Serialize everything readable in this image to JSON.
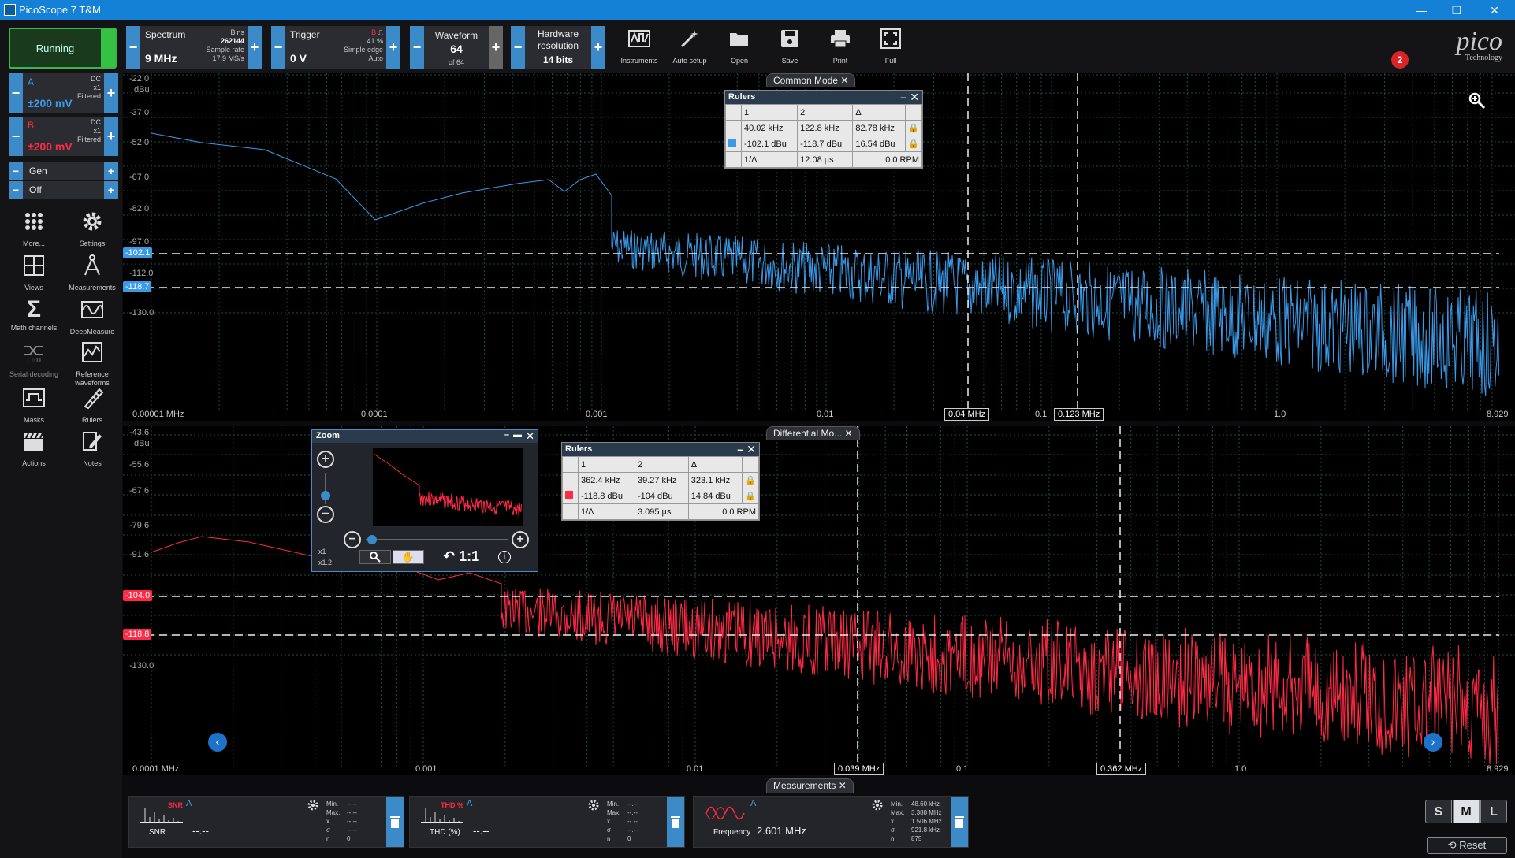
{
  "window": {
    "title": "PicoScope 7 T&M",
    "min": "—",
    "max": "❐",
    "close": "✕"
  },
  "toolbar": {
    "running": "Running",
    "spectrum": {
      "title": "Spectrum",
      "value": "9 MHz",
      "bins_label": "Bins",
      "bins": "262144",
      "rate_label": "Sample rate",
      "rate": "17.9 MS/s"
    },
    "trigger": {
      "title": "Trigger",
      "value": "0 V",
      "channel": "B",
      "percent": "41 %",
      "type": "Simple edge",
      "mode": "Auto"
    },
    "waveform": {
      "title": "Waveform",
      "value": "64",
      "of": "of 64"
    },
    "hardware": {
      "title1": "Hardware",
      "title2": "resolution",
      "value": "14 bits"
    },
    "tools": [
      "Instruments",
      "Auto setup",
      "Open",
      "Save",
      "Print",
      "Full"
    ],
    "logo": "pico",
    "logo_sub": "Technology",
    "badge": "2"
  },
  "channels": [
    {
      "letter": "A",
      "value": "±200 mV",
      "coupling": "DC",
      "probe": "x1",
      "filter": "Filtered",
      "color": "#3a9ae8"
    },
    {
      "letter": "B",
      "value": "±200 mV",
      "coupling": "DC",
      "probe": "x1",
      "filter": "Filtered",
      "color": "#ff2a45"
    }
  ],
  "gen": {
    "label": "Gen",
    "state": "Off"
  },
  "side_tools": [
    {
      "label": "More...",
      "icon": "grid-dots-icon"
    },
    {
      "label": "Settings",
      "icon": "gear-icon"
    },
    {
      "label": "Views",
      "icon": "views-icon"
    },
    {
      "label": "Measurements",
      "icon": "compass-icon"
    },
    {
      "label": "Math channels",
      "icon": "sigma-icon"
    },
    {
      "label": "DeepMeasure",
      "icon": "deepmeasure-icon"
    },
    {
      "label": "Serial decoding",
      "icon": "serial-icon"
    },
    {
      "label": "Reference waveforms",
      "icon": "reference-icon"
    },
    {
      "label": "Masks",
      "icon": "mask-icon"
    },
    {
      "label": "Rulers",
      "icon": "ruler-icon"
    },
    {
      "label": "Actions",
      "icon": "clapper-icon"
    },
    {
      "label": "Notes",
      "icon": "notes-icon"
    }
  ],
  "views": [
    {
      "tab": "Common Mode",
      "color": "#3a9ae8",
      "unit": "dBu",
      "yticks": [
        "-22.0",
        "-37.0",
        "-52.0",
        "-67.0",
        "-82.0",
        "-97.0",
        "-112.0",
        "-130.0"
      ],
      "xticks": [
        "0.00001 MHz",
        "0.0001",
        "0.001",
        "0.01",
        "0.1",
        "1.0",
        "8.929"
      ],
      "ruler_y": [
        "-102.1",
        "-118.7"
      ],
      "ruler_x": [
        "0.04 MHz",
        "0.123 MHz"
      ],
      "rulers": {
        "title": "Rulers",
        "cols": [
          "1",
          "2",
          "Δ"
        ],
        "row_x": [
          "40.02 kHz",
          "122.8 kHz",
          "82.78 kHz"
        ],
        "row_y": [
          "-102.1 dBu",
          "-118.7 dBu",
          "16.54 dBu"
        ],
        "inv_label": "1/Δ",
        "inv": "12.08 µs",
        "rpm": "0.0 RPM"
      }
    },
    {
      "tab": "Differential Mo...",
      "color": "#ff2a45",
      "unit": "dBu",
      "yticks": [
        "-43.6",
        "-55.6",
        "-67.6",
        "-79.6",
        "-91.6",
        "-104.0",
        "-118.8",
        "-130.0"
      ],
      "xticks": [
        "0.0001 MHz",
        "0.001",
        "0.01",
        "0.1",
        "1.0",
        "8.929"
      ],
      "ruler_y": [
        "-104.0",
        "-118.8"
      ],
      "ruler_x": [
        "0.039 MHz",
        "0.362 MHz"
      ],
      "rulers": {
        "title": "Rulers",
        "cols": [
          "1",
          "2",
          "Δ"
        ],
        "row_x": [
          "362.4 kHz",
          "39.27 kHz",
          "323.1 kHz"
        ],
        "row_y": [
          "-118.8 dBu",
          "-104 dBu",
          "14.84 dBu"
        ],
        "inv_label": "1/Δ",
        "inv": "3.095 µs",
        "rpm": "0.0 RPM"
      }
    }
  ],
  "zoom": {
    "title": "Zoom",
    "x1": "x1",
    "x12": "x1.2",
    "ratio": "1:1"
  },
  "measurements": {
    "tab": "Measurements",
    "cards": [
      {
        "name": "SNR",
        "icon_label": "SNR",
        "channel": "A",
        "value": "--.--",
        "min_label": "Min.",
        "min": "--.--",
        "max_label": "Max.",
        "max": "--.--",
        "mean_label": "x̄",
        "mean": "--.--",
        "sigma_label": "σ",
        "sigma": "--.--",
        "n_label": "n",
        "n": "0"
      },
      {
        "name": "THD (%)",
        "icon_label": "THD %",
        "channel": "A",
        "value": "--.--",
        "min_label": "Min.",
        "min": "--.--",
        "max_label": "Max.",
        "max": "--.--",
        "mean_label": "x̄",
        "mean": "--.--",
        "sigma_label": "σ",
        "sigma": "--.--",
        "n_label": "n",
        "n": "0"
      },
      {
        "name": "Frequency",
        "icon_label": "",
        "channel": "A",
        "value": "2.601 MHz",
        "min_label": "Min.",
        "min": "48.60 kHz",
        "max_label": "Max.",
        "max": "3.388 MHz",
        "mean_label": "x̄",
        "mean": "1.506 MHz",
        "sigma_label": "σ",
        "sigma": "921.8 kHz",
        "n_label": "n",
        "n": "875"
      }
    ]
  },
  "size_buttons": [
    "S",
    "M",
    "L"
  ],
  "reset": "Reset"
}
